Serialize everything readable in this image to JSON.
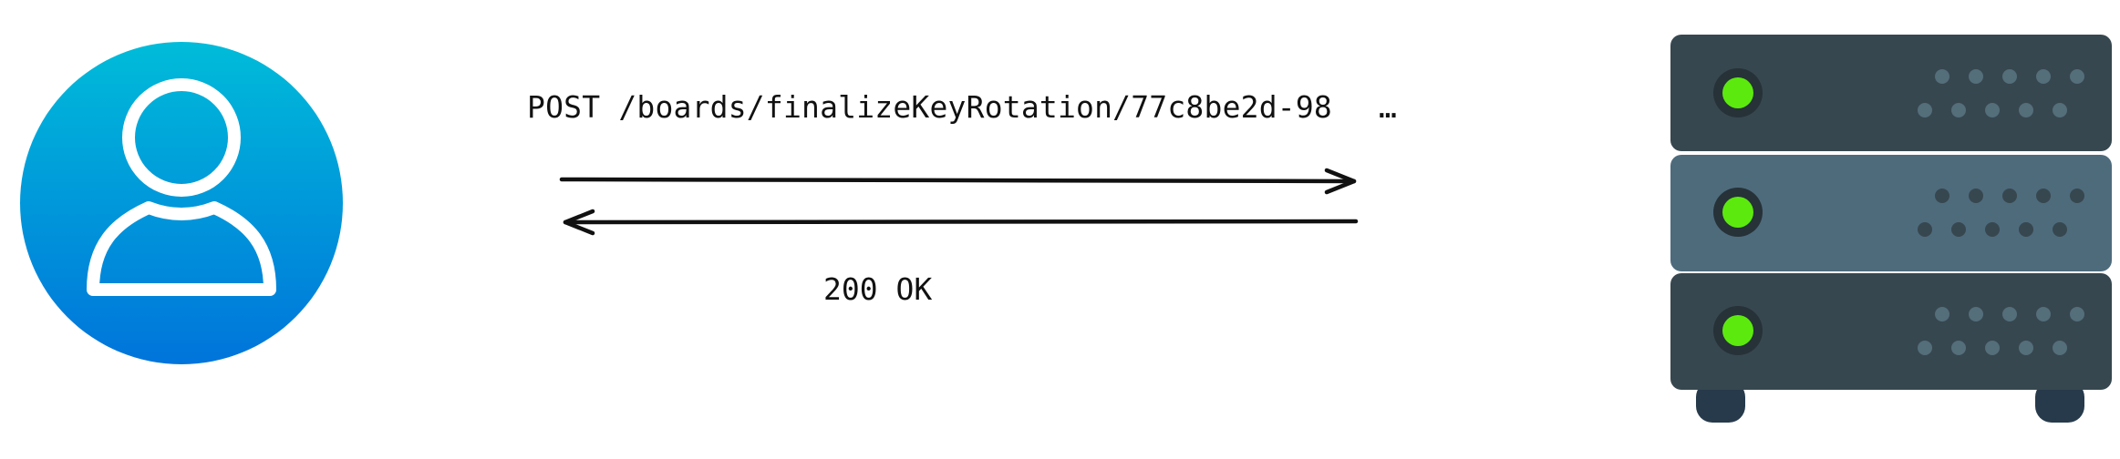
{
  "diagram": {
    "request": {
      "label": "POST /boards/finalizeKeyRotation/77c8be2d-98",
      "ellipsis": "…"
    },
    "response": {
      "label": "200 OK"
    },
    "client": {
      "icon": "user-icon",
      "gradient_top": "#00BCD9",
      "gradient_bottom": "#0074DB"
    },
    "server": {
      "icon": "server-rack-icon",
      "unit_dark": "#37474F",
      "unit_mid": "#4E6B7C",
      "led_color": "#5CEA0E",
      "feet_color": "#263A4B",
      "vent_dark": "#546E7A",
      "vent_mid": "#37474F"
    }
  }
}
